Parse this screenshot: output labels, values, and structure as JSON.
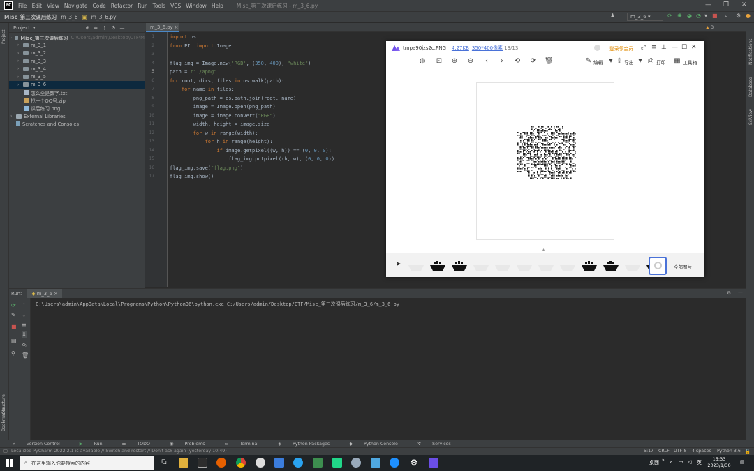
{
  "menubar": {
    "items": [
      "File",
      "Edit",
      "View",
      "Navigate",
      "Code",
      "Refactor",
      "Run",
      "Tools",
      "VCS",
      "Window",
      "Help"
    ],
    "title": "Misc_第三次课后练习 - m_3_6.py"
  },
  "navbar": {
    "crumbs": [
      "Misc_第三次课后练习",
      "m_3_6",
      "m_3_6.py"
    ],
    "run_config": "m_3_6"
  },
  "left_strip": {
    "project": "Project",
    "structure": "Structure",
    "bookmarks": "Bookmarks"
  },
  "right_strip": {
    "notifications": "Notifications",
    "database": "Database",
    "sciview": "SciView"
  },
  "project": {
    "header": "Project",
    "root_name": "Misc_第三次课后练习",
    "root_path": "C:\\Users\\admin\\Desktop\\CTF\\M",
    "folders": [
      "m_3_1",
      "m_3_2",
      "m_3_3",
      "m_3_4",
      "m_3_5",
      "m_3_6"
    ],
    "files": [
      "怎么全是数字.txt",
      "找一个QQ号.zip",
      "课后练习.png"
    ],
    "extras": [
      "External Libraries",
      "Scratches and Consoles"
    ]
  },
  "editor": {
    "tab": "m_3_6.py",
    "warning_count": "3",
    "line_numbers": [
      "1",
      "2",
      "3",
      "4",
      "5",
      "6",
      "7",
      "8",
      "9",
      "10",
      "11",
      "12",
      "13",
      "14",
      "15",
      "16",
      "17"
    ]
  },
  "viewer": {
    "filename": "tmpa90jzs2c.PNG",
    "size": "4.27KB",
    "dimensions": "350*400像素",
    "index": "13/13",
    "login": "登录领会员",
    "toolbar": {
      "edit": "编辑",
      "export": "导出",
      "print": "打印",
      "tools": "工具箱"
    },
    "all_images": "全部图片"
  },
  "run": {
    "label": "Run:",
    "tab": "m_3_6",
    "command": "C:\\Users\\admin\\AppData\\Local\\Programs\\Python\\Python36\\python.exe C:/Users/admin/Desktop/CTF/Misc_第三次课后练习/m_3_6/m_3_6.py"
  },
  "tooltabs": [
    "Version Control",
    "Run",
    "TODO",
    "Problems",
    "Terminal",
    "Python Packages",
    "Python Console",
    "Services"
  ],
  "status": {
    "message": "Localized PyCharm 2022.2.1 is available // Switch and restart // Don't ask again (yesterday 10:49)",
    "position": "5:17",
    "line_sep": "CRLF",
    "encoding": "UTF-8",
    "indent": "4 spaces",
    "interpreter": "Python 3.6"
  },
  "taskbar": {
    "search_placeholder": "在这里输入你要搜索的内容",
    "desktop": "桌面",
    "ime": "英",
    "time": "15:33",
    "date": "2023/1/30"
  },
  "colors": {
    "ide_bg": "#2b2b2b",
    "panel_bg": "#3c3f41",
    "keyword": "#cc7832",
    "string": "#6a8759",
    "number": "#6897bb",
    "selection": "#0d293e",
    "viewer_accent": "#6b4ee6"
  }
}
